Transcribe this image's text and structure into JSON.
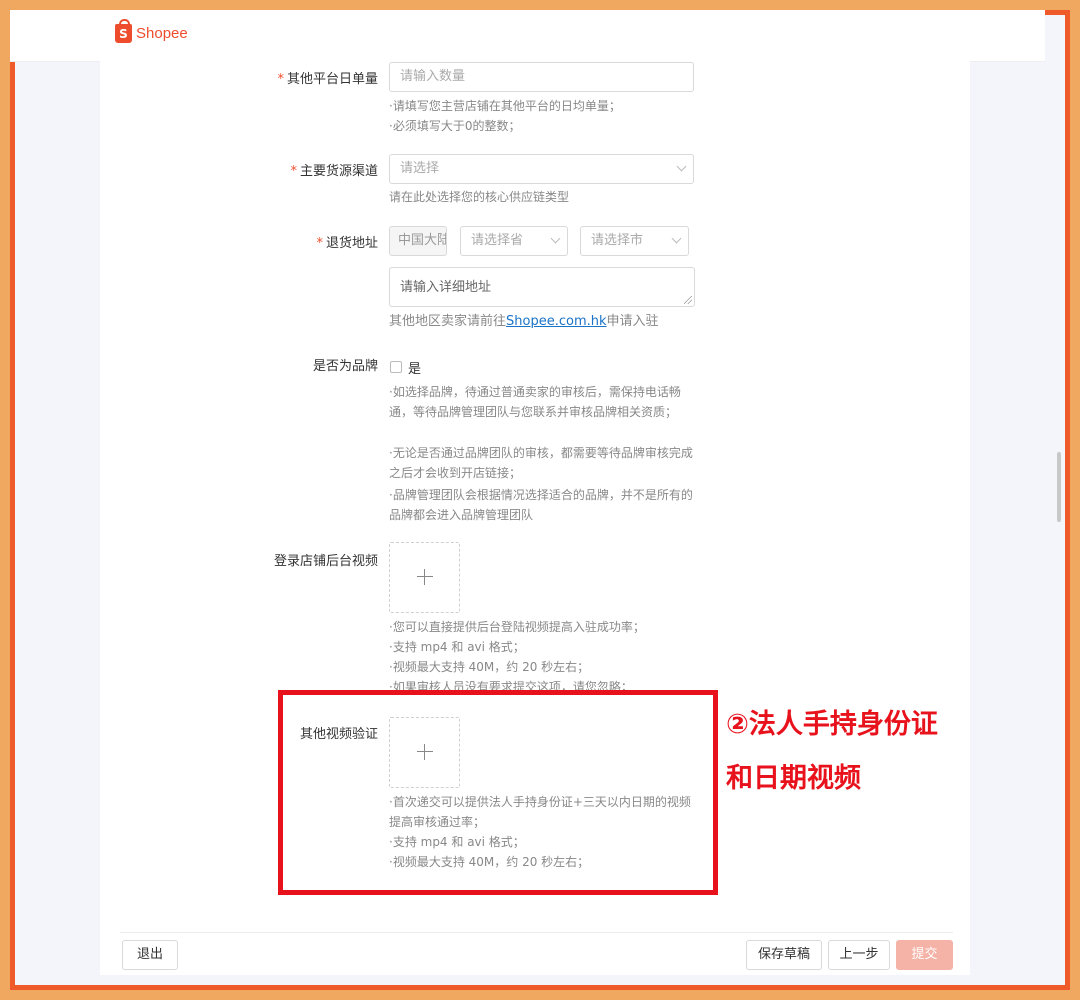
{
  "brand": {
    "logo_letter": "S",
    "name": "Shopee"
  },
  "form": {
    "daily_orders": {
      "required_mark": "*",
      "label": "其他平台日单量",
      "placeholder": "请输入数量",
      "hints": [
        "·请填写您主营店铺在其他平台的日均单量；",
        "·必须填写大于0的整数；"
      ]
    },
    "supply_channel": {
      "required_mark": "*",
      "label": "主要货源渠道",
      "placeholder": "请选择",
      "hint": "请在此处选择您的核心供应链类型"
    },
    "return_address": {
      "required_mark": "*",
      "label": "退货地址",
      "country": "中国大陆",
      "province_placeholder": "请选择省",
      "city_placeholder": "请选择市",
      "detail_placeholder": "请输入详细地址",
      "hint_prefix": "其他地区卖家请前往",
      "hint_link": "Shopee.com.hk",
      "hint_suffix": "申请入驻"
    },
    "is_brand": {
      "label": "是否为品牌",
      "checkbox_label": "是",
      "hints": [
        "·如选择品牌，待通过普通卖家的审核后，需保持电话畅通，等待品牌管理团队与您联系并审核品牌相关资质；",
        "·无论是否通过品牌团队的审核，都需要等待品牌审核完成之后才会收到开店链接；",
        "·品牌管理团队会根据情况选择适合的品牌，并不是所有的品牌都会进入品牌管理团队"
      ]
    },
    "login_video": {
      "label": "登录店铺后台视频",
      "hints": [
        "·您可以直接提供后台登陆视频提高入驻成功率；",
        "·支持 mp4 和 avi 格式；",
        "·视频最大支持 40M，约 20 秒左右；",
        "·如果审核人员没有要求提交这项，请您忽略；"
      ]
    },
    "other_video": {
      "label": "其他视频验证",
      "hints": [
        "·首次递交可以提供法人手持身份证+三天以内日期的视频提高审核通过率；",
        "·支持 mp4 和 avi 格式；",
        "·视频最大支持 40M，约 20 秒左右；"
      ]
    }
  },
  "annotation": {
    "line1": "②法人手持身份证",
    "line2": "和日期视频",
    "color": "#e8121c"
  },
  "footer": {
    "exit": "退出",
    "save_draft": "保存草稿",
    "prev": "上一步",
    "submit": "提交"
  },
  "colors": {
    "brand": "#ee4d2d",
    "frame": "#ee5a2a",
    "outer": "#f0a860",
    "submit_disabled": "#f4b3a6",
    "link": "#1a73c7"
  }
}
